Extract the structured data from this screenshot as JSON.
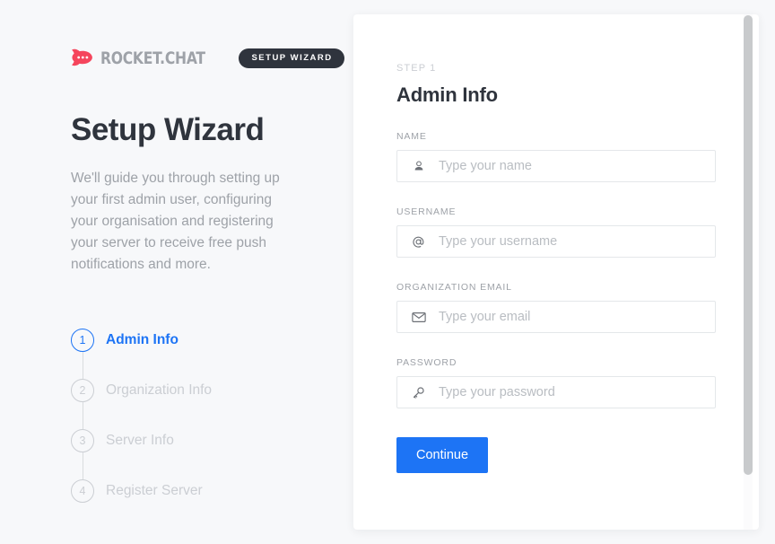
{
  "brand": {
    "logo_icon": "rocketchat-logo-icon",
    "name": "ROCKET.CHAT",
    "badge": "SETUP WIZARD",
    "logo_color": "#f5455c",
    "badge_bg": "#2f343d"
  },
  "intro": {
    "title": "Setup Wizard",
    "description": "We'll guide you through setting up your first admin user, configuring your organisation and registering your server to receive free push notifications and more."
  },
  "stepper": {
    "steps": [
      {
        "number": "1",
        "label": "Admin Info",
        "state": "active"
      },
      {
        "number": "2",
        "label": "Organization Info",
        "state": "pending"
      },
      {
        "number": "3",
        "label": "Server Info",
        "state": "pending"
      },
      {
        "number": "4",
        "label": "Register Server",
        "state": "pending"
      }
    ],
    "active_color": "#1d74f5",
    "pending_color": "#cbced3"
  },
  "form": {
    "eyebrow": "STEP 1",
    "title": "Admin Info",
    "fields": [
      {
        "label": "NAME",
        "placeholder": "Type your name",
        "value": "",
        "icon": "user-icon",
        "name": "name-field"
      },
      {
        "label": "USERNAME",
        "placeholder": "Type your username",
        "value": "",
        "icon": "at-sign-icon",
        "name": "username-field"
      },
      {
        "label": "ORGANIZATION EMAIL",
        "placeholder": "Type your email",
        "value": "",
        "icon": "envelope-icon",
        "name": "organization-email-field"
      },
      {
        "label": "PASSWORD",
        "placeholder": "Type your password",
        "value": "",
        "icon": "key-icon",
        "name": "password-field"
      }
    ],
    "submit_label": "Continue",
    "submit_color": "#1d74f5"
  },
  "scrollbar": {
    "thumb_color": "#c8cacc",
    "track_color": "#fbfbfc"
  },
  "theme": {
    "page_bg": "#f7f8fa",
    "card_bg": "#ffffff",
    "text_primary": "#2f343d",
    "text_muted": "#9ea2a8"
  }
}
